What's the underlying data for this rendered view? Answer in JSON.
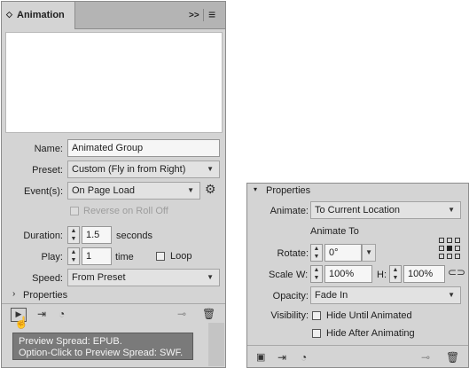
{
  "left_panel": {
    "tab_title": "Animation",
    "collapse_glyph": ">>",
    "menu_glyph": "≡",
    "name_label": "Name:",
    "name_value": "Animated Group",
    "preset_label": "Preset:",
    "preset_value": "Custom (Fly in from Right)",
    "events_label": "Event(s):",
    "events_value": "On Page Load",
    "reverse_label": "Reverse on Roll Off",
    "duration_label": "Duration:",
    "duration_value": "1.5",
    "duration_unit": "seconds",
    "play_label": "Play:",
    "play_value": "1",
    "play_unit": "time",
    "loop_label": "Loop",
    "speed_label": "Speed:",
    "speed_value": "From Preset",
    "properties_label": "Properties",
    "tooltip_line1": "Preview Spread: EPUB.",
    "tooltip_line2": "Option-Click to Preview Spread: SWF."
  },
  "right_panel": {
    "properties_label": "Properties",
    "animate_label": "Animate:",
    "animate_value": "To Current Location",
    "animate_to_heading": "Animate To",
    "rotate_label": "Rotate:",
    "rotate_value": "0°",
    "scale_label": "Scale",
    "w_label": "W:",
    "w_value": "100%",
    "h_label": "H:",
    "h_value": "100%",
    "opacity_label": "Opacity:",
    "opacity_value": "Fade In",
    "visibility_label": "Visibility:",
    "hide_until_label": "Hide Until Animated",
    "hide_after_label": "Hide After Animating"
  },
  "colors": {
    "panel_bg": "#d4d4d4",
    "tab_bar_bg": "#b4b4b4",
    "field_bg": "#f6f6f6",
    "tooltip_bg": "#7a7a7a"
  }
}
